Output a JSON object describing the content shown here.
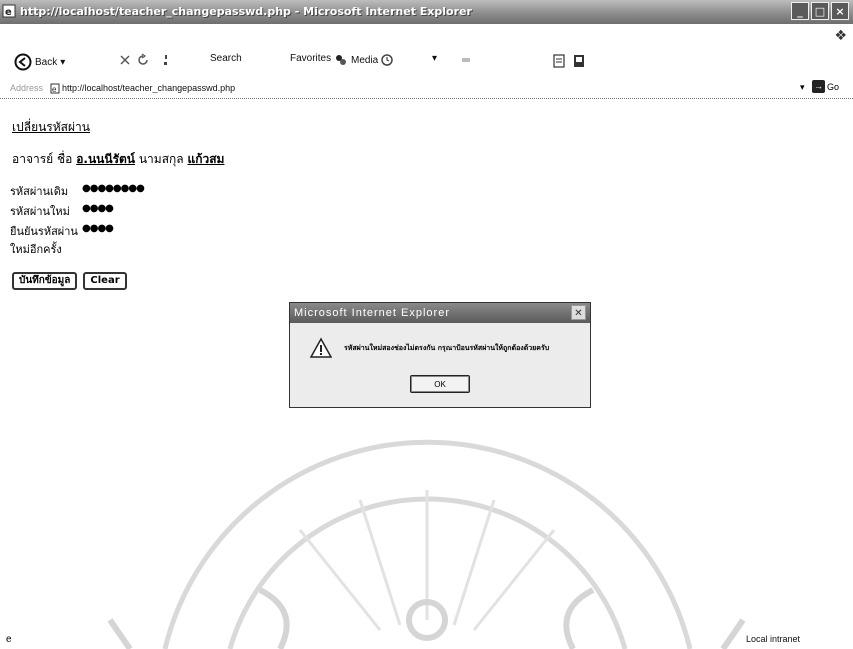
{
  "window": {
    "title": "http://localhost/teacher_changepasswd.php - Microsoft Internet Explorer",
    "buttons": [
      "_",
      "□",
      "×"
    ]
  },
  "toolbar": {
    "back_label": "Back",
    "search_label": "Search",
    "favorites_label": "Favorites",
    "media_label": "Media"
  },
  "address": {
    "label": "Address",
    "url": "http://localhost/teacher_changepasswd.php",
    "go_label": "Go"
  },
  "page": {
    "title": "เปลี่ยนรหัสผ่าน",
    "teacher_prefix": "อาจารย์ ชื่อ",
    "teacher_name": "อ.นนนีรัตน์",
    "surname_prefix": "นามสกุล",
    "teacher_surname": "แก้วสม",
    "fields": [
      {
        "label": "รหัสผ่านเดิม",
        "dots": "●●●●●●●●"
      },
      {
        "label": "รหัสผ่านใหม่",
        "dots": "●●●●"
      },
      {
        "label": "ยืนยันรหัสผ่าน",
        "dots": "●●●●"
      },
      {
        "label": "ใหม่อีกครั้ง",
        "dots": ""
      }
    ],
    "save_label": "บันทึกข้อมูล",
    "clear_label": "Clear"
  },
  "dialog": {
    "title": "Microsoft Internet Explorer",
    "message": "รหัสผ่านใหม่สองช่องไม่ตรงกัน กรุณาป้อนรหัสผ่านให้ถูกต้องด้วยครับ",
    "ok_label": "OK"
  },
  "status": {
    "zone": "Local intranet"
  }
}
